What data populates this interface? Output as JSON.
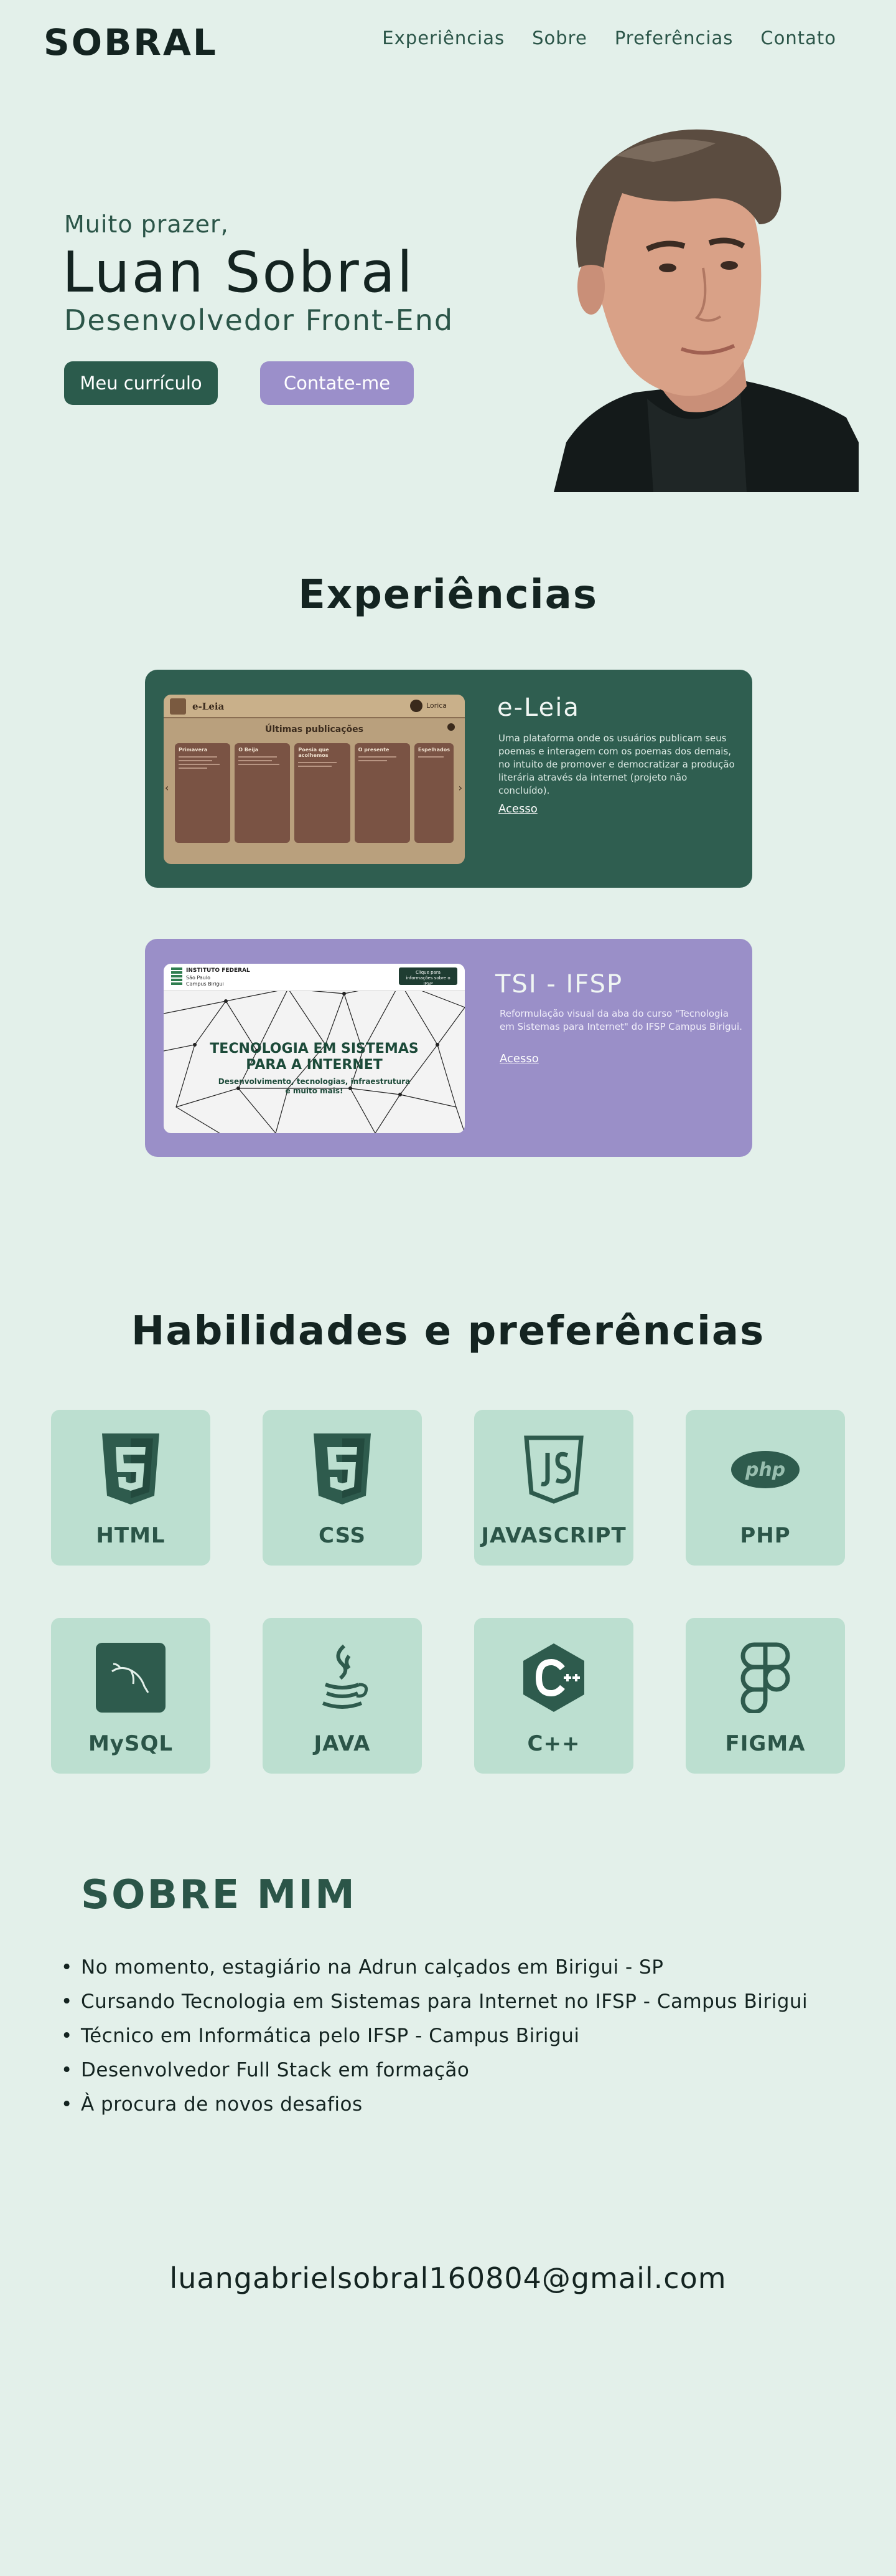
{
  "nav": {
    "logo": "SOBRAL",
    "items": [
      "Experiências",
      "Sobre",
      "Preferências",
      "Contato"
    ]
  },
  "hero": {
    "greeting": "Muito prazer,",
    "name": "Luan Sobral",
    "role": "Desenvolvedor Front-End",
    "cv_button": "Meu currículo",
    "contact_button": "Contate-me"
  },
  "experiences": {
    "title": "Experiências",
    "projects": [
      {
        "title": "e-Leia",
        "description": "Uma plataforma onde os usuários publicam seus poemas e interagem com os poemas dos demais, no intuito de promover e democratizar a produção literária através da internet (projeto não concluído).",
        "link": "Acesso",
        "thumb": {
          "brand": "e-Leia",
          "user": "Lorica",
          "heading": "Últimas publicações",
          "posts": [
            "Primavera",
            "O Beija",
            "Poesia que acolhemos",
            "O presente",
            "Espelhados"
          ]
        }
      },
      {
        "title": "TSI - IFSP",
        "description": "Reformulação visual da aba do curso \"Tecnologia em Sistemas para Internet\" do IFSP Campus Birigui.",
        "link": "Acesso",
        "thumb": {
          "org": "INSTITUTO FEDERAL",
          "campus": "São Paulo",
          "campus2": "Campus Birigui",
          "badge": "Clique para informações sobre o IFSP",
          "headline1": "TECNOLOGIA EM SISTEMAS",
          "headline2": "PARA A INTERNET",
          "sub1": "Desenvolvimento, tecnologias, infraestrutura",
          "sub2": "e muito mais!"
        }
      }
    ]
  },
  "skills": {
    "title": "Habilidades e preferências",
    "items": [
      {
        "label": "HTML",
        "icon": "html5-icon"
      },
      {
        "label": "CSS",
        "icon": "css3-icon"
      },
      {
        "label": "JAVASCRIPT",
        "icon": "javascript-icon"
      },
      {
        "label": "PHP",
        "icon": "php-icon"
      },
      {
        "label": "MySQL",
        "icon": "mysql-icon"
      },
      {
        "label": "JAVA",
        "icon": "java-icon"
      },
      {
        "label": "C++",
        "icon": "cplusplus-icon"
      },
      {
        "label": "FIGMA",
        "icon": "figma-icon"
      }
    ]
  },
  "about": {
    "title": "SOBRE MIM",
    "items": [
      "No momento, estagiário na Adrun calçados em Birigui - SP",
      "Cursando Tecnologia em Sistemas para Internet no IFSP - Campus Birigui",
      "Técnico em Informática pelo IFSP - Campus Birigui",
      "Desenvolvedor Full Stack em formação",
      "À procura de novos desafios"
    ]
  },
  "contact": {
    "email": "luangabrielsobral160804@gmail.com"
  },
  "colors": {
    "background": "#e3f0ea",
    "primary_green": "#2b5b4c",
    "accent_purple": "#9b8fca",
    "skill_card": "#bcdfd0",
    "text_dark": "#142421"
  }
}
